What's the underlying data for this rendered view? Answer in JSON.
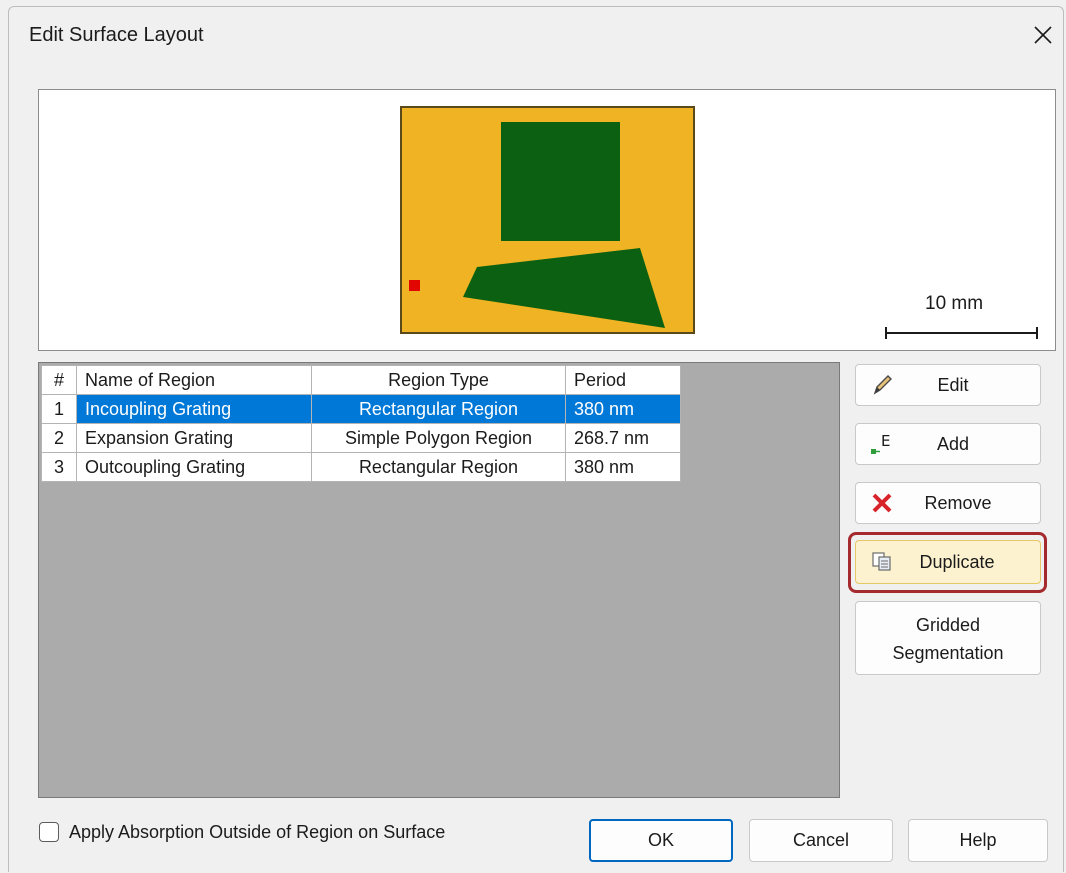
{
  "window": {
    "title": "Edit Surface Layout",
    "close_icon": "close-icon"
  },
  "preview": {
    "scale_label": "10 mm",
    "colors": {
      "surface": "#f0b323",
      "region": "#0c6012",
      "marker": "#e10600"
    }
  },
  "table": {
    "columns": [
      "#",
      "Name of Region",
      "Region Type",
      "Period"
    ],
    "rows": [
      {
        "num": "1",
        "name": "Incoupling Grating",
        "type": "Rectangular Region",
        "period": "380 nm",
        "selected": true
      },
      {
        "num": "2",
        "name": "Expansion Grating",
        "type": "Simple Polygon Region",
        "period": "268.7 nm",
        "selected": false
      },
      {
        "num": "3",
        "name": "Outcoupling Grating",
        "type": "Rectangular Region",
        "period": "380 nm",
        "selected": false
      }
    ]
  },
  "side_buttons": {
    "edit": "Edit",
    "add": "Add",
    "remove": "Remove",
    "duplicate": "Duplicate",
    "gridded_line1": "Gridded",
    "gridded_line2": "Segmentation"
  },
  "footer": {
    "checkbox_label": "Apply Absorption Outside of Region on Surface",
    "checkbox_checked": false,
    "ok": "OK",
    "cancel": "Cancel",
    "help": "Help"
  },
  "colors": {
    "selection": "#0078d7",
    "highlight_border": "#a52a2e",
    "duplicate_bg": "#fcf2cf"
  }
}
